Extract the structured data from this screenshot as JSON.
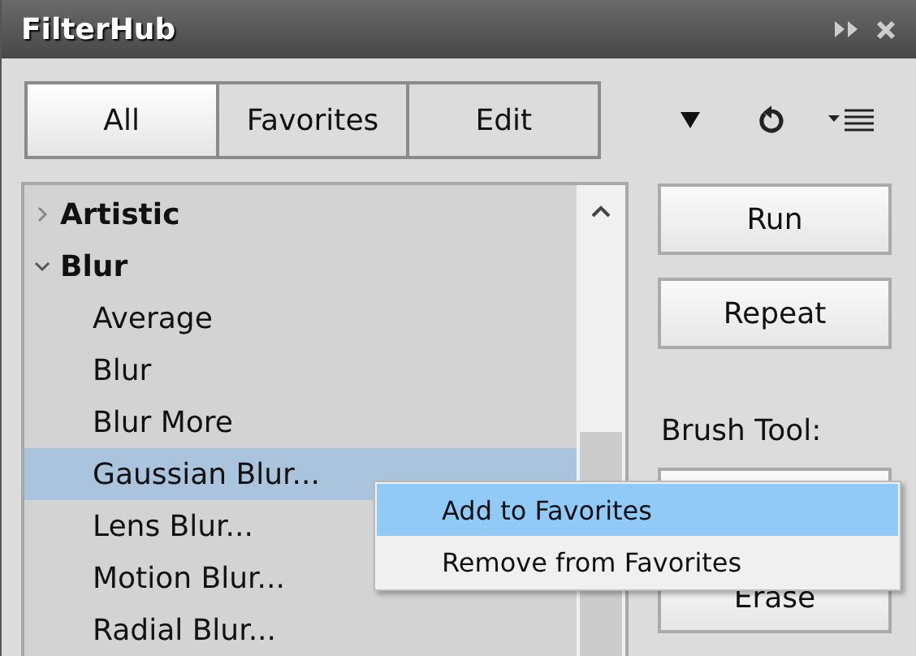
{
  "window": {
    "title": "FilterHub"
  },
  "tabs": [
    {
      "label": "All",
      "selected": true
    },
    {
      "label": "Favorites",
      "selected": false
    },
    {
      "label": "Edit",
      "selected": false
    }
  ],
  "tree": [
    {
      "label": "Artistic",
      "expanded": false
    },
    {
      "label": "Blur",
      "expanded": true,
      "children": [
        {
          "label": "Average",
          "selected": false
        },
        {
          "label": "Blur",
          "selected": false
        },
        {
          "label": "Blur More",
          "selected": false
        },
        {
          "label": "Gaussian Blur...",
          "selected": true
        },
        {
          "label": "Lens Blur...",
          "selected": false
        },
        {
          "label": "Motion Blur...",
          "selected": false
        },
        {
          "label": "Radial Blur...",
          "selected": false
        }
      ]
    }
  ],
  "actions": [
    "Run",
    "Repeat"
  ],
  "brush_tool": {
    "label": "Brush Tool:",
    "buttons": [
      "Erase"
    ]
  },
  "context_menu": [
    {
      "label": "Add to Favorites",
      "selected": true
    },
    {
      "label": "Remove from Favorites",
      "selected": false
    }
  ]
}
